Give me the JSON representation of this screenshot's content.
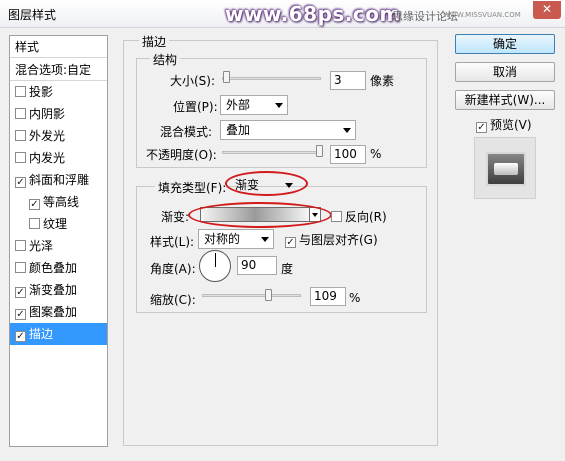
{
  "window": {
    "title": "图层样式",
    "close_symbol": "✕",
    "watermark": "www.68ps.com",
    "watermark_right": "思缘设计论坛",
    "watermark_small": "WWW.MISSVUAN.COM"
  },
  "stylelist": {
    "header": "样式",
    "blend": "混合选项:自定",
    "items": [
      {
        "label": "投影",
        "checked": false
      },
      {
        "label": "内阴影",
        "checked": false
      },
      {
        "label": "外发光",
        "checked": false
      },
      {
        "label": "内发光",
        "checked": false
      },
      {
        "label": "斜面和浮雕",
        "checked": true
      },
      {
        "label": "等高线",
        "checked": true
      },
      {
        "label": "纹理",
        "checked": false
      },
      {
        "label": "光泽",
        "checked": false
      },
      {
        "label": "颜色叠加",
        "checked": false
      },
      {
        "label": "渐变叠加",
        "checked": true
      },
      {
        "label": "图案叠加",
        "checked": true
      },
      {
        "label": "描边",
        "checked": true
      }
    ]
  },
  "stroke": {
    "group_title": "描边",
    "structure_title": "结构",
    "size_label": "大小(S):",
    "size_value": "3",
    "size_unit": "像素",
    "position_label": "位置(P):",
    "position_value": "外部",
    "blend_label": "混合模式:",
    "blend_value": "叠加",
    "opacity_label": "不透明度(O):",
    "opacity_value": "100",
    "opacity_unit": "%",
    "fill_type_label": "填充类型(F):",
    "fill_type_value": "渐变",
    "gradient_label": "渐变:",
    "reverse_label": "反向(R)",
    "style_label": "样式(L):",
    "style_value": "对称的",
    "align_label": "与图层对齐(G)",
    "angle_label": "角度(A):",
    "angle_value": "90",
    "angle_unit": "度",
    "scale_label": "缩放(C):",
    "scale_value": "109",
    "scale_unit": "%"
  },
  "buttons": {
    "ok": "确定",
    "cancel": "取消",
    "new_style": "新建样式(W)...",
    "preview": "预览(V)"
  },
  "colors": {
    "selection": "#3399ff",
    "highlight_ellipse": "#d11a1a"
  }
}
